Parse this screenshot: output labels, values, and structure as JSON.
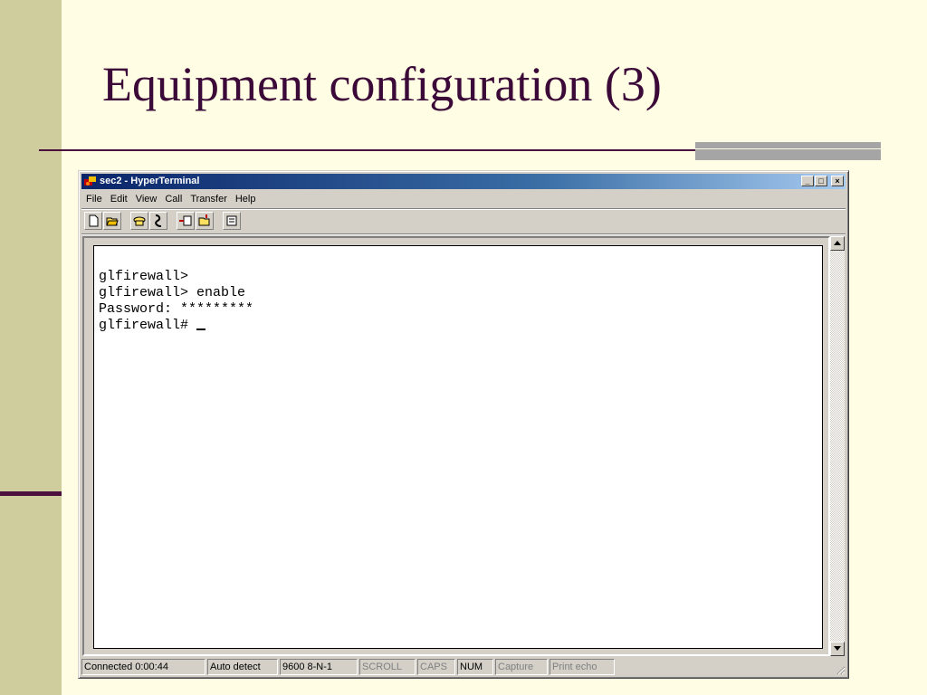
{
  "slide": {
    "title": "Equipment configuration (3)"
  },
  "window": {
    "title": "sec2 - HyperTerminal",
    "controls": {
      "minimize": "_",
      "maximize": "□",
      "close": "×"
    },
    "menu": [
      "File",
      "Edit",
      "View",
      "Call",
      "Transfer",
      "Help"
    ],
    "toolbar_icons": [
      "new-icon",
      "open-icon",
      "connect-icon",
      "disconnect-icon",
      "send-icon",
      "receive-icon",
      "properties-icon"
    ]
  },
  "terminal": {
    "lines": [
      "glfirewall>",
      "glfirewall> enable",
      "Password: *********",
      "glfirewall#"
    ]
  },
  "statusbar": {
    "connected": "Connected 0:00:44",
    "detect": "Auto detect",
    "settings": "9600 8-N-1",
    "scroll": "SCROLL",
    "caps": "CAPS",
    "num": "NUM",
    "capture": "Capture",
    "print_echo": "Print echo"
  },
  "colors": {
    "background": "#FFFDE3",
    "sidebar": "#CFCD9E",
    "accent": "#4A0F3D",
    "title_text": "#3C0A38"
  }
}
